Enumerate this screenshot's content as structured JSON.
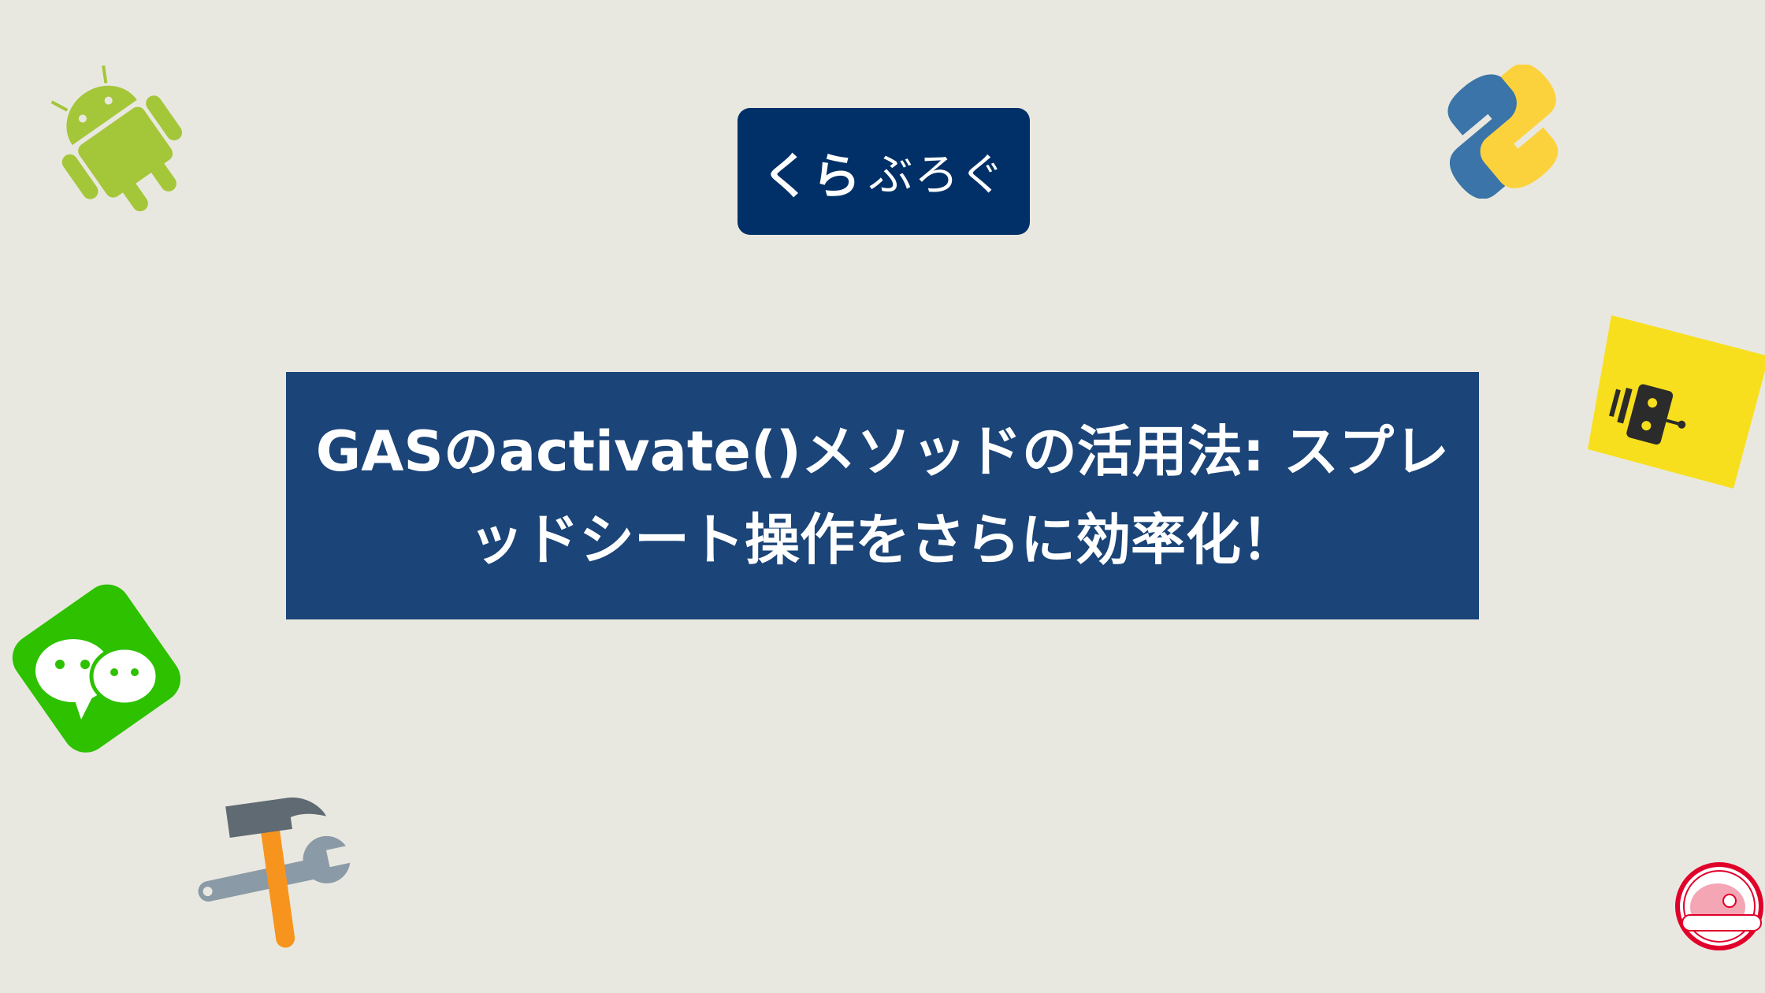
{
  "logo": {
    "main": "くら",
    "sub": "ぶろぐ",
    "color": "#003067"
  },
  "title": "GASのactivate()メソッドの活用法: スプレッドシート操作をさらに効率化！",
  "colors": {
    "background": "#e9e8e0",
    "title_box": "#1b4478"
  },
  "decorations": [
    "android-icon",
    "python-icon",
    "robot-sticker-icon",
    "wechat-icon",
    "tools-icon",
    "avatar-stamp-icon"
  ]
}
